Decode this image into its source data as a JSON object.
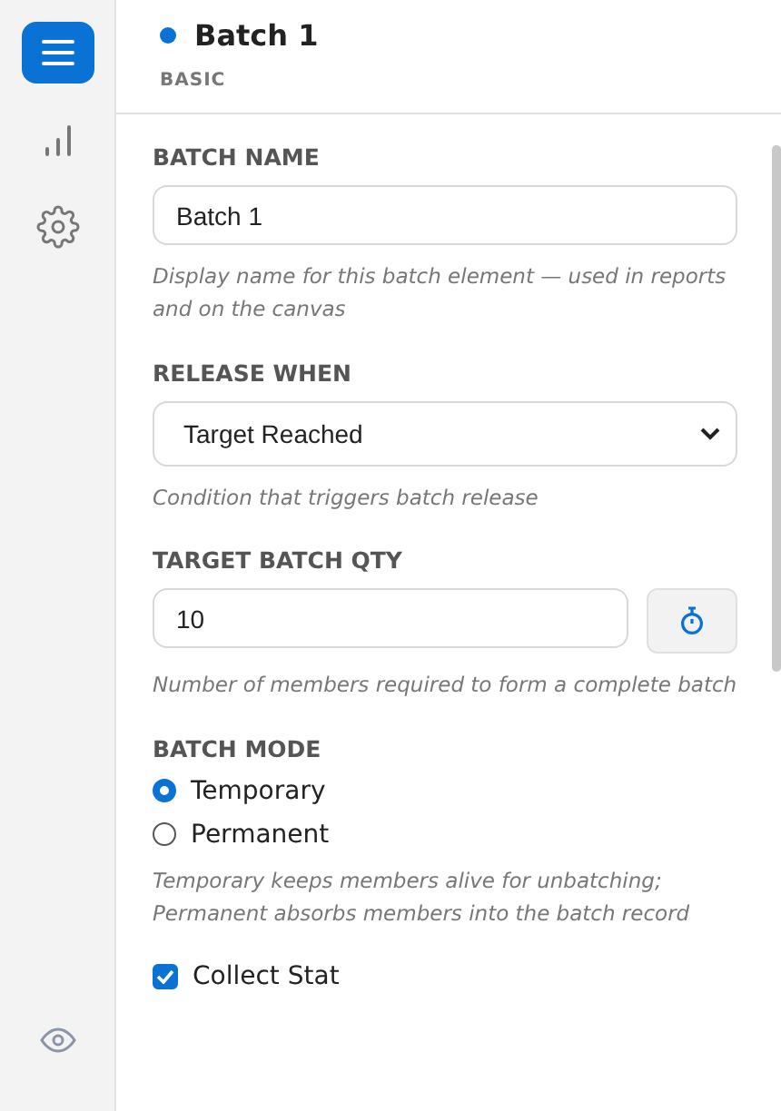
{
  "sidebar": {
    "items": [
      {
        "kind": "menu",
        "selected": true
      },
      {
        "kind": "chart",
        "selected": false
      },
      {
        "kind": "settings",
        "selected": false
      }
    ],
    "footer": [
      {
        "kind": "eye",
        "selected": false
      }
    ]
  },
  "header": {
    "title": "Batch 1",
    "color": "#0a72d4",
    "subtitle": "BASIC"
  },
  "fields": [
    {
      "kind": "text",
      "label": "BATCH NAME",
      "value": "Batch 1",
      "help": "Display name for this batch element — used in reports and on the canvas"
    },
    {
      "kind": "select",
      "label": "RELEASE WHEN",
      "value": "Target Reached",
      "help": "Condition that triggers batch release"
    },
    {
      "kind": "number",
      "label": "TARGET BATCH QTY",
      "value": "10",
      "help": "Number of members required to form a complete batch"
    },
    {
      "kind": "radio",
      "label": "BATCH MODE",
      "options": [
        {
          "label": "Temporary",
          "selected": true
        },
        {
          "label": "Permanent",
          "selected": false
        }
      ],
      "help": "Temporary keeps members alive for unbatching; Permanent absorbs members into the batch record"
    },
    {
      "kind": "checkbox",
      "label": "Collect Stat",
      "checked": true
    }
  ]
}
